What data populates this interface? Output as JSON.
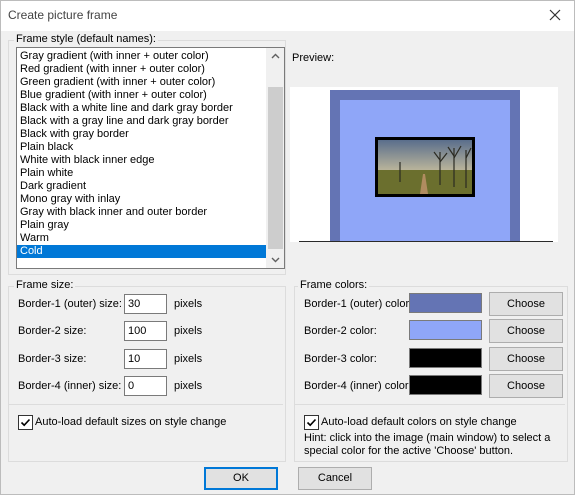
{
  "window": {
    "title": "Create picture frame"
  },
  "style_group": {
    "legend": "Frame style (default names):",
    "items": [
      "Gray gradient (with inner + outer color)",
      "Red gradient (with inner + outer color)",
      "Green gradient (with inner + outer color)",
      "Blue gradient (with inner + outer color)",
      "Black with a white line and dark gray border",
      "Black with a gray line and dark gray border",
      "Black with gray border",
      "Plain black",
      "White with black inner edge",
      "Plain white",
      "Dark gradient",
      "Mono gray with inlay",
      "Gray with black inner and outer border",
      "Plain gray",
      "Warm",
      "Cold"
    ],
    "selected": "Cold"
  },
  "preview": {
    "label": "Preview:"
  },
  "size_group": {
    "legend": "Frame size:",
    "rows": [
      {
        "label": "Border-1 (outer) size:",
        "value": "30",
        "unit": "pixels"
      },
      {
        "label": "Border-2 size:",
        "value": "100",
        "unit": "pixels"
      },
      {
        "label": "Border-3 size:",
        "value": "10",
        "unit": "pixels"
      },
      {
        "label": "Border-4 (inner) size:",
        "value": "0",
        "unit": "pixels"
      }
    ],
    "autoload_label": "Auto-load default sizes on style change",
    "autoload_checked": true
  },
  "color_group": {
    "legend": "Frame colors:",
    "rows": [
      {
        "label": "Border-1 (outer) color:",
        "color": "#6474b4",
        "button": "Choose"
      },
      {
        "label": "Border-2 color:",
        "color": "#8fa6f8",
        "button": "Choose"
      },
      {
        "label": "Border-3 color:",
        "color": "#000000",
        "button": "Choose"
      },
      {
        "label": "Border-4 (inner) color:",
        "color": "#000000",
        "button": "Choose"
      }
    ],
    "autoload_label": "Auto-load default colors on style change",
    "autoload_checked": true,
    "hint": "Hint: click into the image (main window) to select a special color for the active 'Choose' button."
  },
  "buttons": {
    "ok": "OK",
    "cancel": "Cancel"
  }
}
